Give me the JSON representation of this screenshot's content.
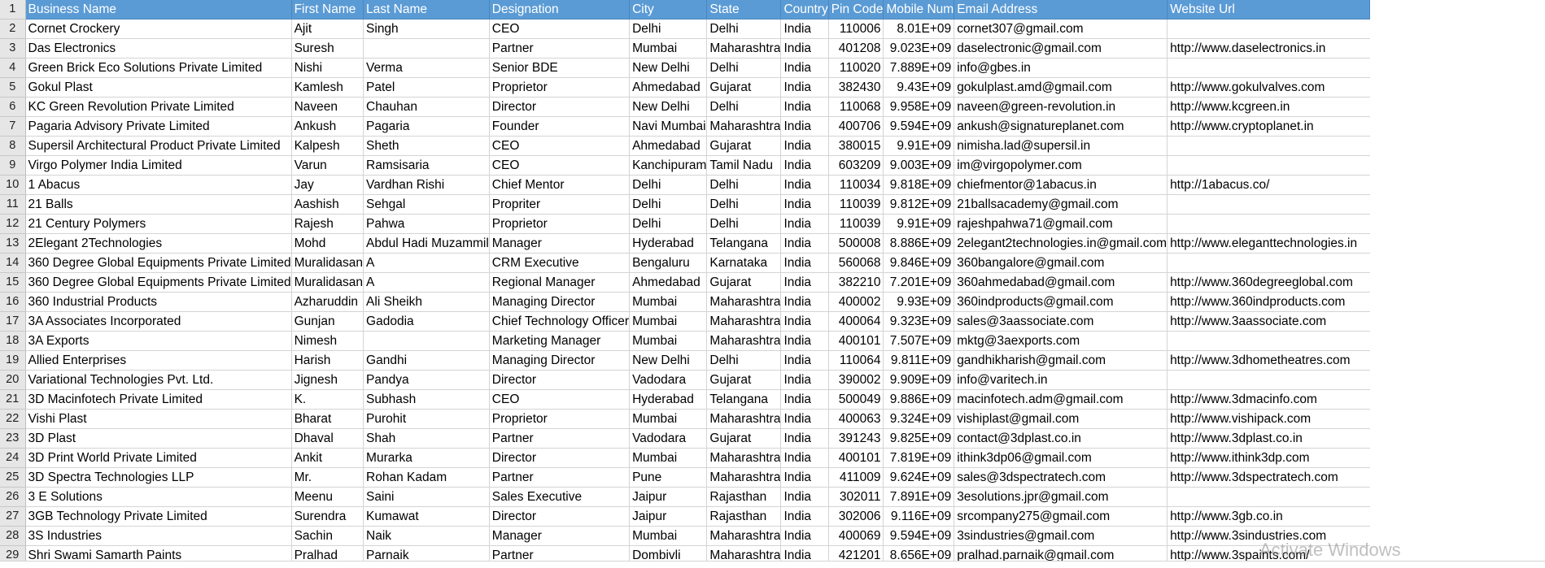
{
  "sheet": {
    "headers": [
      "Business Name",
      "First Name",
      "Last Name",
      "Designation",
      "City",
      "State",
      "Country",
      "Pin Code",
      "Mobile Num",
      "Email Address",
      "Website Url"
    ],
    "rows": [
      [
        "Cornet Crockery",
        "Ajit",
        "Singh",
        "CEO",
        "Delhi",
        "Delhi",
        "India",
        "110006",
        "8.01E+09",
        "cornet307@gmail.com",
        ""
      ],
      [
        "Das Electronics",
        "Suresh",
        "",
        "Partner",
        "Mumbai",
        "Maharashtra",
        "India",
        "401208",
        "9.023E+09",
        "daselectronic@gmail.com",
        "http://www.daselectronics.in"
      ],
      [
        "Green Brick Eco Solutions Private Limited",
        "Nishi",
        "Verma",
        "Senior BDE",
        "New Delhi",
        "Delhi",
        "India",
        "110020",
        "7.889E+09",
        "info@gbes.in",
        ""
      ],
      [
        "Gokul Plast",
        "Kamlesh",
        "Patel",
        "Proprietor",
        "Ahmedabad",
        "Gujarat",
        "India",
        "382430",
        "9.43E+09",
        "gokulplast.amd@gmail.com",
        "http://www.gokulvalves.com"
      ],
      [
        "KC Green Revolution Private Limited",
        "Naveen",
        "Chauhan",
        "Director",
        "New Delhi",
        "Delhi",
        "India",
        "110068",
        "9.958E+09",
        "naveen@green-revolution.in",
        "http://www.kcgreen.in"
      ],
      [
        "Pagaria Advisory Private Limited",
        "Ankush",
        "Pagaria",
        "Founder",
        "Navi Mumbai",
        "Maharashtra",
        "India",
        "400706",
        "9.594E+09",
        "ankush@signatureplanet.com",
        "http://www.cryptoplanet.in"
      ],
      [
        "Supersil Architectural Product Private Limited",
        "Kalpesh",
        "Sheth",
        "CEO",
        "Ahmedabad",
        "Gujarat",
        "India",
        "380015",
        "9.91E+09",
        "nimisha.lad@supersil.in",
        ""
      ],
      [
        "Virgo Polymer India Limited",
        "Varun",
        "Ramsisaria",
        "CEO",
        "Kanchipuram",
        "Tamil Nadu",
        "India",
        "603209",
        "9.003E+09",
        "im@virgopolymer.com",
        ""
      ],
      [
        "1 Abacus",
        "Jay",
        "Vardhan  Rishi",
        "Chief Mentor",
        "Delhi",
        "Delhi",
        "India",
        "110034",
        "9.818E+09",
        "chiefmentor@1abacus.in",
        "http://1abacus.co/"
      ],
      [
        "21 Balls",
        "Aashish",
        "Sehgal",
        "Propriter",
        "Delhi",
        "Delhi",
        "India",
        "110039",
        "9.812E+09",
        "21ballsacademy@gmail.com",
        ""
      ],
      [
        "21 Century Polymers",
        "Rajesh",
        "Pahwa",
        "Proprietor",
        "Delhi",
        "Delhi",
        "India",
        "110039",
        "9.91E+09",
        "rajeshpahwa71@gmail.com",
        ""
      ],
      [
        "2Elegant 2Technologies",
        "Mohd",
        "Abdul Hadi Muzammil",
        "Manager",
        "Hyderabad",
        "Telangana",
        "India",
        "500008",
        "8.886E+09",
        "2elegant2technologies.in@gmail.com",
        "http://www.eleganttechnologies.in"
      ],
      [
        "360 Degree Global Equipments Private Limited",
        "Muralidasan",
        "A",
        "CRM Executive",
        "Bengaluru",
        "Karnataka",
        "India",
        "560068",
        "9.846E+09",
        "360bangalore@gmail.com",
        ""
      ],
      [
        "360 Degree Global Equipments Private Limited",
        "Muralidasan",
        "A",
        "Regional Manager",
        "Ahmedabad",
        "Gujarat",
        "India",
        "382210",
        "7.201E+09",
        "360ahmedabad@gmail.com",
        "http://www.360degreeglobal.com"
      ],
      [
        "360 Industrial Products",
        "Azharuddin",
        "Ali Sheikh",
        "Managing Director",
        "Mumbai",
        "Maharashtra",
        "India",
        "400002",
        "9.93E+09",
        "360indproducts@gmail.com",
        "http://www.360indproducts.com"
      ],
      [
        "3A Associates Incorporated",
        "Gunjan",
        "Gadodia",
        "Chief Technology Officer",
        "Mumbai",
        "Maharashtra",
        "India",
        "400064",
        "9.323E+09",
        "sales@3aassociate.com",
        "http://www.3aassociate.com"
      ],
      [
        "3A Exports",
        "Nimesh",
        "",
        "Marketing Manager",
        "Mumbai",
        "Maharashtra",
        "India",
        "400101",
        "7.507E+09",
        "mktg@3aexports.com",
        ""
      ],
      [
        "Allied Enterprises",
        "Harish",
        "Gandhi",
        "Managing Director",
        "New Delhi",
        "Delhi",
        "India",
        "110064",
        "9.811E+09",
        "gandhikharish@gmail.com",
        "http://www.3dhometheatres.com"
      ],
      [
        "Variational Technologies Pvt. Ltd.",
        "Jignesh",
        "Pandya",
        "Director",
        "Vadodara",
        "Gujarat",
        "India",
        "390002",
        "9.909E+09",
        "info@varitech.in",
        ""
      ],
      [
        "3D Macinfotech Private Limited",
        "K.",
        "Subhash",
        "CEO",
        "Hyderabad",
        "Telangana",
        "India",
        "500049",
        "9.886E+09",
        "macinfotech.adm@gmail.com",
        "http://www.3dmacinfo.com"
      ],
      [
        "Vishi Plast",
        "Bharat",
        "Purohit",
        "Proprietor",
        "Mumbai",
        "Maharashtra",
        "India",
        "400063",
        "9.324E+09",
        "vishiplast@gmail.com",
        "http://www.vishipack.com"
      ],
      [
        "3D Plast",
        "Dhaval",
        "Shah",
        "Partner",
        "Vadodara",
        "Gujarat",
        "India",
        "391243",
        "9.825E+09",
        "contact@3dplast.co.in",
        "http://www.3dplast.co.in"
      ],
      [
        "3D Print World Private Limited",
        "Ankit",
        "Murarka",
        "Director",
        "Mumbai",
        "Maharashtra",
        "India",
        "400101",
        "7.819E+09",
        "ithink3dp06@gmail.com",
        "http://www.ithink3dp.com"
      ],
      [
        "3D Spectra Technologies LLP",
        "Mr.",
        "Rohan Kadam",
        "Partner",
        "Pune",
        "Maharashtra",
        "India",
        "411009",
        "9.624E+09",
        "sales@3dspectratech.com",
        "http://www.3dspectratech.com"
      ],
      [
        "3 E Solutions",
        "Meenu",
        "Saini",
        "Sales Executive",
        "Jaipur",
        "Rajasthan",
        "India",
        "302011",
        "7.891E+09",
        "3esolutions.jpr@gmail.com",
        ""
      ],
      [
        "3GB Technology Private Limited",
        "Surendra",
        "Kumawat",
        "Director",
        "Jaipur",
        "Rajasthan",
        "India",
        "302006",
        "9.116E+09",
        "srcompany275@gmail.com",
        "http://www.3gb.co.in"
      ],
      [
        "3S Industries",
        "Sachin",
        "Naik",
        "Manager",
        "Mumbai",
        "Maharashtra",
        "India",
        "400069",
        "9.594E+09",
        "3sindustries@gmail.com",
        "http://www.3sindustries.com"
      ],
      [
        "Shri Swami Samarth Paints",
        "Pralhad",
        "Parnaik",
        "Partner",
        "Dombivli",
        "Maharashtra",
        "India",
        "421201",
        "8.656E+09",
        "pralhad.parnaik@gmail.com",
        "http://www.3spaints.com/"
      ]
    ]
  },
  "overlay": {
    "watermark": "Activate Windows"
  },
  "colors": {
    "header_bg": "#5b9bd5",
    "header_text": "#ffffff",
    "row_header_bg": "#e6e6e6",
    "grid": "#d4d4d4"
  }
}
